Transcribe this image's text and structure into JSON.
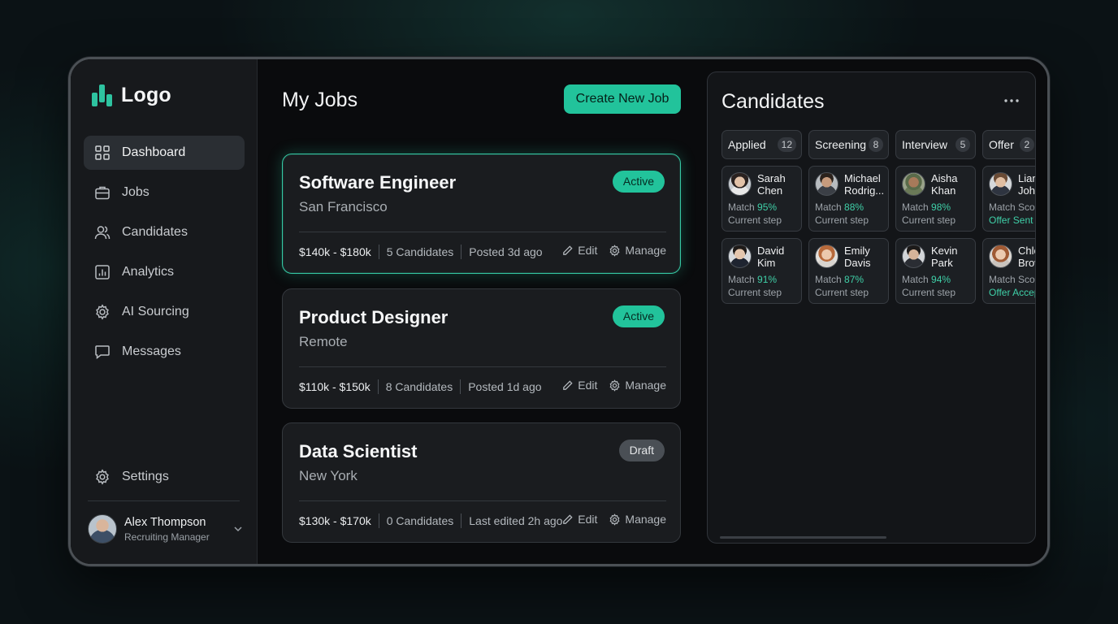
{
  "brand": {
    "logo_text": "Logo",
    "accent": "#22c39b"
  },
  "sidebar": {
    "items": [
      {
        "label": "Dashboard",
        "icon": "grid-icon",
        "active": true
      },
      {
        "label": "Jobs",
        "icon": "briefcase-icon"
      },
      {
        "label": "Candidates",
        "icon": "users-icon"
      },
      {
        "label": "Analytics",
        "icon": "chart-icon"
      },
      {
        "label": "AI Sourcing",
        "icon": "ai-gear-icon"
      },
      {
        "label": "Messages",
        "icon": "message-icon"
      }
    ],
    "settings_label": "Settings",
    "user": {
      "name": "Alex Thompson",
      "role": "Recruiting Manager"
    }
  },
  "jobs": {
    "title": "My Jobs",
    "create_label": "Create New Job",
    "edit_label": "Edit",
    "manage_label": "Manage",
    "list": [
      {
        "title": "Software Engineer",
        "location": "San Francisco",
        "status": "Active",
        "salary": "$140k - $180k",
        "candidates": "5 Candidates",
        "posted": "Posted 3d ago"
      },
      {
        "title": "Product Designer",
        "location": "Remote",
        "status": "Active",
        "salary": "$110k - $150k",
        "candidates": "8 Candidates",
        "posted": "Posted 1d ago"
      },
      {
        "title": "Data Scientist",
        "location": "New York",
        "status": "Draft",
        "salary": "$130k - $170k",
        "candidates": "0 Candidates",
        "posted": "Last edited 2h ago"
      }
    ]
  },
  "candidates": {
    "title": "Candidates",
    "columns": [
      {
        "name": "Applied",
        "count": "12",
        "cards": [
          {
            "first": "Sarah",
            "last": "Chen",
            "label": "Match",
            "pct": "95%",
            "step": "Current step"
          },
          {
            "first": "David",
            "last": "Kim",
            "label": "Match",
            "pct": "91%",
            "step": "Current step"
          }
        ]
      },
      {
        "name": "Screening",
        "count": "8",
        "cards": [
          {
            "first": "Michael",
            "last": "Rodrig...",
            "label": "Match",
            "pct": "88%",
            "step": "Current step"
          },
          {
            "first": "Emily",
            "last": "Davis",
            "label": "Match",
            "pct": "87%",
            "step": "Current step"
          }
        ]
      },
      {
        "name": "Interview",
        "count": "5",
        "cards": [
          {
            "first": "Aisha",
            "last": "Khan",
            "label": "Match",
            "pct": "98%",
            "step": "Current step"
          },
          {
            "first": "Kevin",
            "last": "Park",
            "label": "Match",
            "pct": "94%",
            "step": "Current step"
          }
        ]
      },
      {
        "name": "Offer",
        "count": "2",
        "cards": [
          {
            "first": "Liam",
            "last": "Johnson",
            "label": "Match Score",
            "pct": "",
            "step": "Offer Sent"
          },
          {
            "first": "Chloe",
            "last": "Brown",
            "label": "Match Score",
            "pct": "",
            "step": "Offer Accepted"
          }
        ]
      }
    ]
  }
}
